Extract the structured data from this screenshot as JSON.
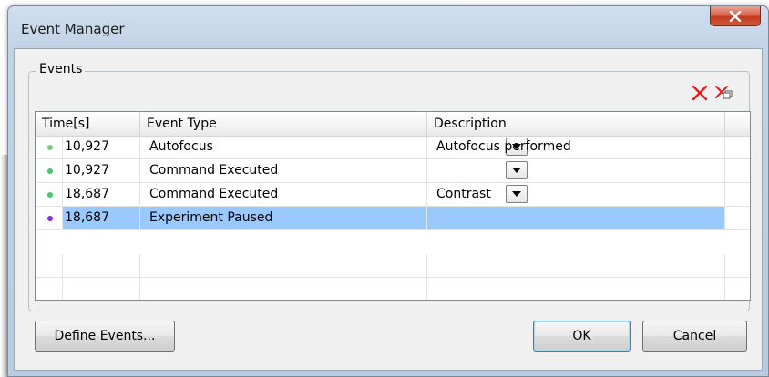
{
  "window": {
    "title": "Event Manager"
  },
  "events_group": {
    "label": "Events"
  },
  "grid": {
    "columns": [
      "Time[s]",
      "Event Type",
      "Description"
    ],
    "rows": [
      {
        "time": "10,927",
        "type": "Autofocus",
        "description": "Autofocus performed",
        "dot_color": "#7fc97f",
        "selected": false
      },
      {
        "time": "10,927",
        "type": "Command Executed",
        "description": "",
        "dot_color": "#4cc36a",
        "selected": false
      },
      {
        "time": "18,687",
        "type": "Command Executed",
        "description": "Contrast",
        "dot_color": "#4cc36a",
        "selected": false
      },
      {
        "time": "18,687",
        "type": "Experiment Paused",
        "description": "",
        "dot_color": "#8a2be2",
        "selected": true
      }
    ]
  },
  "buttons": {
    "define_events": "Define Events...",
    "ok": "OK",
    "cancel": "Cancel"
  },
  "icons": {
    "delete": "delete-x-icon",
    "delete_all": "delete-all-icon",
    "close": "close-icon"
  },
  "colors": {
    "selection": "#99c9ff",
    "delete_red": "#e02020"
  }
}
